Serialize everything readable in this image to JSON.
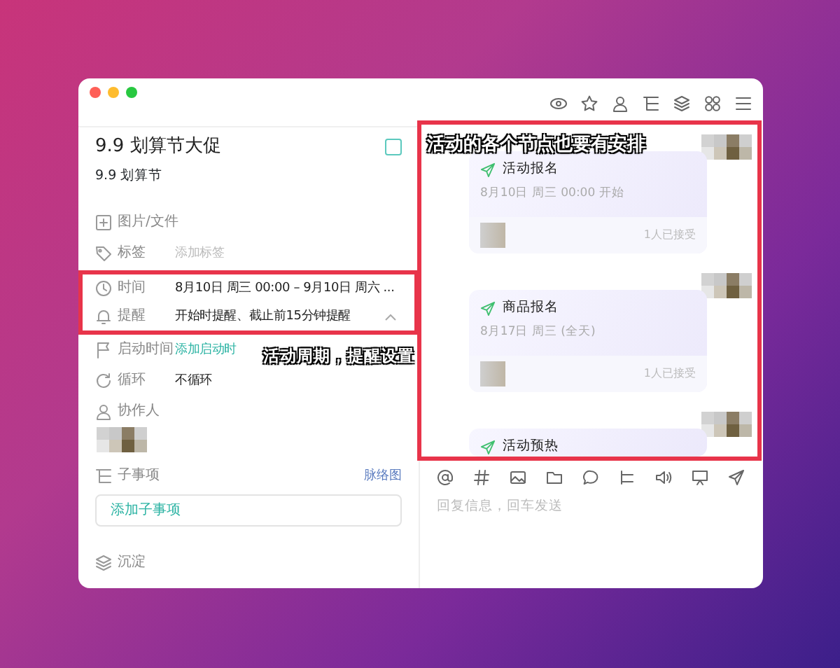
{
  "task": {
    "title": "9.9 划算节大促",
    "checked": false,
    "subtitle": "9.9 划算节"
  },
  "fields": [
    {
      "kind": "files",
      "label": "图片/文件"
    },
    {
      "kind": "tags",
      "label": "标签",
      "placeholder": "添加标签"
    },
    {
      "kind": "time",
      "label": "时间",
      "value": "8月10日 周三 00:00 – 9月10日 周六 ..."
    },
    {
      "kind": "reminder",
      "label": "提醒",
      "value": "开始时提醒、截止前15分钟提醒",
      "expanded": true
    },
    {
      "kind": "start",
      "label": "启动时间",
      "link": "添加启动时"
    },
    {
      "kind": "repeat",
      "label": "循环",
      "value": "不循环"
    },
    {
      "kind": "people",
      "label": "协作人"
    }
  ],
  "subtasks": {
    "label": "子事项",
    "link": "脉络图",
    "add_button": "添加子事项"
  },
  "deposit": {
    "label": "沉淀"
  },
  "messages": [
    {
      "title": "活动报名",
      "time": "8月10日 周三 00:00 开始",
      "accepted": "1人已接受"
    },
    {
      "title": "商品报名",
      "time": "8月17日 周三 (全天)",
      "accepted": "1人已接受"
    },
    {
      "title": "活动预热"
    }
  ],
  "composer": {
    "placeholder": "回复信息，回车发送"
  },
  "annotations": [
    {
      "kind": "chat",
      "text": "活动的各个节点也要有安排"
    },
    {
      "kind": "fields",
      "text": "活动周期，提醒设置"
    }
  ]
}
